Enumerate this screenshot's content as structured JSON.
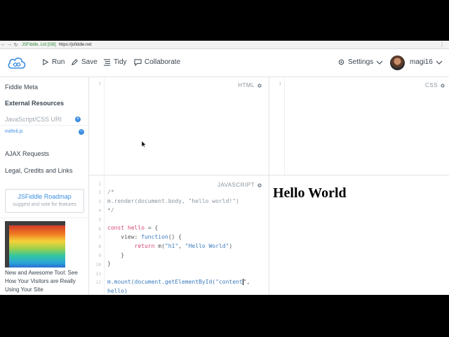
{
  "browser": {
    "back": "←",
    "forward": "→",
    "reload": "↻",
    "site_info": "JSFiddle, Ltd [GB]",
    "url": "https://jsfiddle.net",
    "menu": "⋮"
  },
  "toolbar": {
    "run_label": "Run",
    "save_label": "Save",
    "tidy_label": "Tidy",
    "collaborate_label": "Collaborate",
    "settings_label": "Settings",
    "username": "magi16"
  },
  "sidebar": {
    "fiddle_meta": "Fiddle Meta",
    "external_resources": "External Resources",
    "uri_placeholder": "JavaScript/CSS URI",
    "resource": "mithril.js",
    "ajax": "AJAX Requests",
    "legal": "Legal, Credits and Links",
    "roadmap_title": "JSFiddle Roadmap",
    "roadmap_sub": "suggest and vote for features",
    "promo_text": "New and Awesome Tool: See How Your Visitors are Really Using Your Site"
  },
  "panels": {
    "html_label": "HTML",
    "css_label": "CSS",
    "js_label": "JAVASCRIPT"
  },
  "code": {
    "line_numbers": [
      "1",
      "2",
      "3",
      "4",
      "5",
      "6",
      "7",
      "8",
      "9",
      "10",
      "11",
      "12"
    ],
    "l1": "/*",
    "l2": "m.render(document.body, \"hello world!\")",
    "l3": "*/",
    "l5_kw": "const",
    "l5_name": "hello",
    "l5_rest": " = {",
    "l6_a": "    view: ",
    "l6_fn": "function",
    "l6_b": "() {",
    "l7_a": "        ",
    "l7_kw": "return",
    "l7_b": " m(",
    "l7_s1": "\"h1\"",
    "l7_c": ", ",
    "l7_s2": "\"Hello World\"",
    "l7_d": ")",
    "l8": "    }",
    "l9": "}",
    "l11_a": "m.mount(",
    "l11_fn": "document.getElementById(",
    "l11_s": "\"content",
    "l11_after": "\",",
    "l12": "hello)"
  },
  "result": {
    "heading": "Hello World"
  }
}
